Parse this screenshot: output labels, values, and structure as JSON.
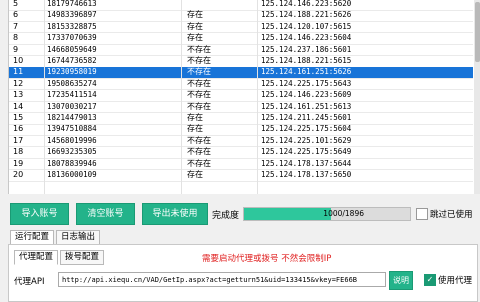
{
  "grid": {
    "rows": [
      {
        "idx": "5",
        "phone": "18179746613",
        "status": "",
        "proxy": "125.124.146.223:5620"
      },
      {
        "idx": "6",
        "phone": "14983396897",
        "status": "存在",
        "proxy": "125.124.188.221:5626"
      },
      {
        "idx": "7",
        "phone": "18153328875",
        "status": "存在",
        "proxy": "125.124.120.107:5615"
      },
      {
        "idx": "8",
        "phone": "17337070639",
        "status": "存在",
        "proxy": "125.124.146.223:5604"
      },
      {
        "idx": "9",
        "phone": "14668059649",
        "status": "不存在",
        "proxy": "125.124.237.186:5601"
      },
      {
        "idx": "10",
        "phone": "16744736582",
        "status": "不存在",
        "proxy": "125.124.188.221:5615"
      },
      {
        "idx": "11",
        "phone": "19230958019",
        "status": "不存在",
        "proxy": "125.124.161.251:5626"
      },
      {
        "idx": "12",
        "phone": "19508635274",
        "status": "不存在",
        "proxy": "125.124.225.175:5643"
      },
      {
        "idx": "13",
        "phone": "17235411514",
        "status": "不存在",
        "proxy": "125.124.146.223:5609"
      },
      {
        "idx": "14",
        "phone": "13070030217",
        "status": "不存在",
        "proxy": "125.124.161.251:5613"
      },
      {
        "idx": "15",
        "phone": "18214479013",
        "status": "存在",
        "proxy": "125.124.211.245:5601"
      },
      {
        "idx": "16",
        "phone": "13947510884",
        "status": "存在",
        "proxy": "125.124.225.175:5604"
      },
      {
        "idx": "17",
        "phone": "14568019996",
        "status": "不存在",
        "proxy": "125.124.225.101:5629"
      },
      {
        "idx": "18",
        "phone": "16693235305",
        "status": "不存在",
        "proxy": "125.124.225.175:5649"
      },
      {
        "idx": "19",
        "phone": "18078839946",
        "status": "不存在",
        "proxy": "125.124.178.137:5644"
      },
      {
        "idx": "20",
        "phone": "18136000109",
        "status": "存在",
        "proxy": "125.124.178.137:5650"
      }
    ]
  },
  "toolbar": {
    "import_label": "导入账号",
    "clear_label": "清空账号",
    "export_label": "导出未使用",
    "progress_label": "完成度",
    "progress_text": "1000/1896",
    "progress_fraction": 0.527,
    "skip_used_label": "跳过已使用"
  },
  "tabs": {
    "run_config": "运行配置",
    "log_output": "日志输出"
  },
  "subtabs": {
    "proxy_config": "代理配置",
    "dial_config": "拨号配置"
  },
  "notice": "需要启动代理或拨号 不然会限制IP",
  "proxy": {
    "label": "代理API",
    "value": "http://api.xiequ.cn/VAD/GetIp.aspx?act=getturn51&uid=133415&vkey=FE66B",
    "help_label": "说明",
    "use_proxy_label": "使用代理"
  },
  "colors": {
    "selected_row": "#1874d8",
    "accent": "#23b38a",
    "notice": "#e02020"
  }
}
